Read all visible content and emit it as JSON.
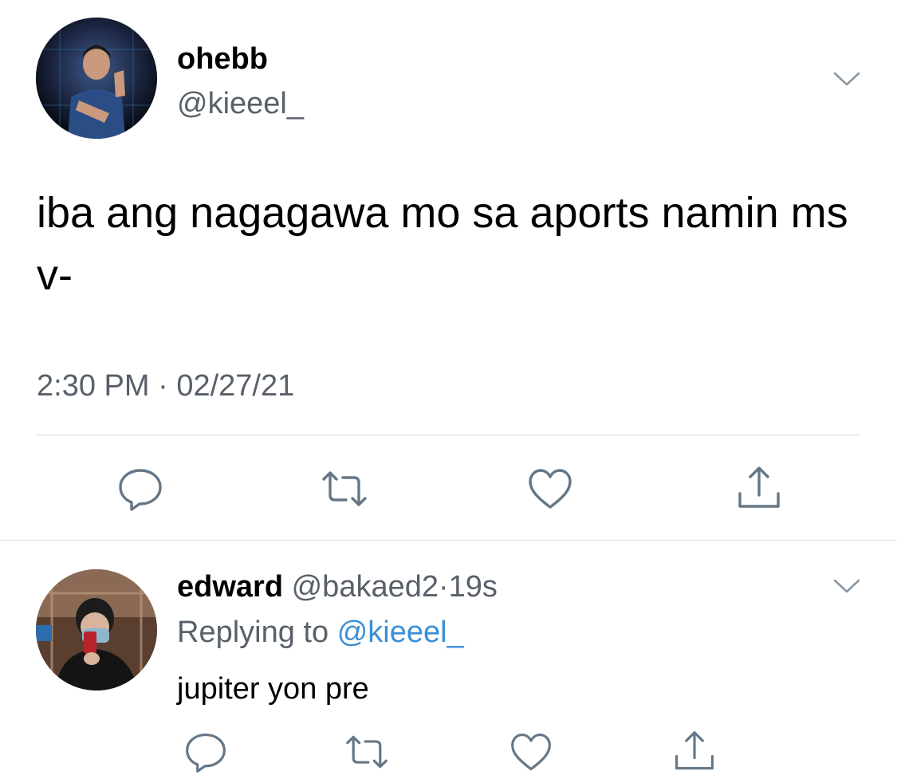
{
  "main_tweet": {
    "display_name": "ohebb",
    "handle": "@kieeel_",
    "text": "iba ang nagagawa mo sa aports namin ms v-",
    "time": "2:30 PM",
    "separator": "·",
    "date": "02/27/21",
    "actions": [
      "reply-icon",
      "retweet-icon",
      "like-icon",
      "share-icon"
    ]
  },
  "reply_tweet": {
    "display_name": "edward",
    "handle": "@bakaed2",
    "separator": "·",
    "age": "19s",
    "replying_label": "Replying to",
    "replying_handle": "@kieeel_",
    "text": "jupiter yon pre",
    "actions": [
      "reply-icon",
      "retweet-icon",
      "like-icon",
      "share-icon"
    ]
  },
  "colors": {
    "text_primary": "#000000",
    "text_secondary": "#586069",
    "link": "#3b8fd6",
    "icon": "#657786",
    "divider": "#d9d9d9"
  }
}
